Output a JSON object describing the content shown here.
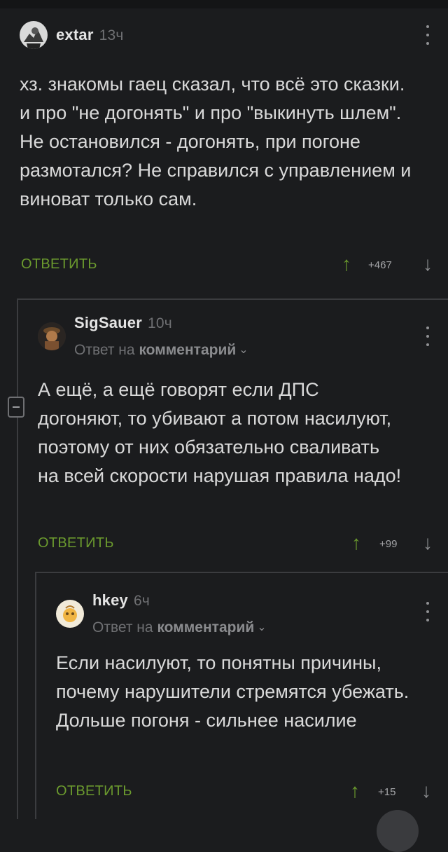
{
  "comments": [
    {
      "user": "extar",
      "time": "13ч",
      "text": "хз. знакомы гаец сказал, что всё это сказки. и про \"не догонять\" и про \"выкинуть шлем\". Не остановился  - догонять, при погоне размотался? Не справился с управлением и виноват только сам.",
      "reply_label": "ОТВЕТИТЬ",
      "score": "+467"
    },
    {
      "user": "SigSauer",
      "time": "10ч",
      "reply_prefix": "Ответ на",
      "reply_target": "комментарий",
      "text": "А ещё, а ещё говорят если ДПС догоняют, то убивают а потом насилуют, поэтому от них обязательно сваливать на всей скорости нарушая правила надо!",
      "reply_label": "ОТВЕТИТЬ",
      "score": "+99"
    },
    {
      "user": "hkey",
      "time": "6ч",
      "reply_prefix": "Ответ на",
      "reply_target": "комментарий",
      "text": "Если насилуют, то понятны причины, почему нарушители стремятся убежать. Дольше погоня - сильнее насилие",
      "reply_label": "ОТВЕТИТЬ",
      "score": "+15"
    }
  ],
  "icons": {
    "up": "arrow-up-icon",
    "down": "arrow-down-icon",
    "more": "more-vertical-icon",
    "collapse": "collapse-minus-icon",
    "chevron": "chevron-down-icon"
  },
  "colors": {
    "background": "#1b1c1e",
    "accent_green": "#6b9a2e",
    "text": "#d9d9d9",
    "muted": "#6f7073"
  }
}
